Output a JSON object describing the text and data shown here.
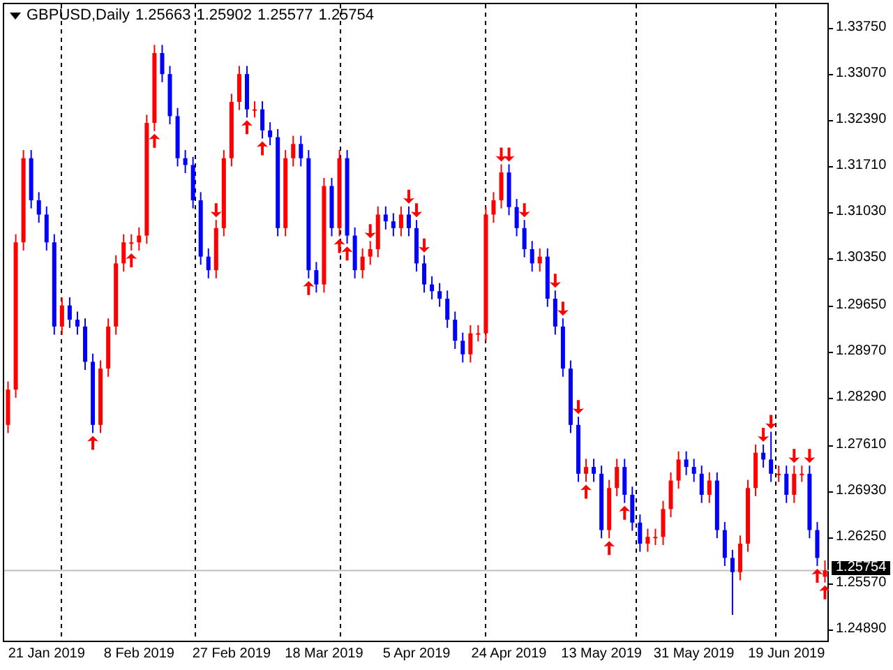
{
  "header": {
    "symbol_timeframe": "GBPUSD,Daily",
    "ohlc": [
      "1.25663",
      "1.25902",
      "1.25577",
      "1.25754"
    ]
  },
  "chart": {
    "chart_data": {
      "type": "candlestick",
      "categories": [
        null,
        null,
        null,
        null,
        null,
        "21 Jan 2019",
        null,
        null,
        null,
        null,
        null,
        null,
        null,
        null,
        null,
        null,
        null,
        "8 Feb 2019",
        null,
        null,
        null,
        null,
        null,
        null,
        null,
        null,
        null,
        null,
        null,
        "27 Feb 2019",
        null,
        null,
        null,
        null,
        null,
        null,
        null,
        null,
        null,
        null,
        null,
        "18 Mar 2019",
        null,
        null,
        null,
        null,
        null,
        null,
        null,
        null,
        null,
        null,
        null,
        "5 Apr 2019",
        null,
        null,
        null,
        null,
        null,
        null,
        null,
        null,
        null,
        null,
        null,
        "24 Apr 2019",
        null,
        null,
        null,
        null,
        null,
        null,
        null,
        null,
        null,
        null,
        null,
        "13 May 2019",
        null,
        null,
        null,
        null,
        null,
        null,
        null,
        null,
        null,
        null,
        null,
        "31 May 2019",
        null,
        null,
        null,
        null,
        null,
        null,
        null,
        null,
        null,
        null,
        null,
        "19 Jun 2019",
        null,
        null,
        null,
        null,
        null
      ],
      "ref_lines": [
        {
          "axis": "y",
          "value": 1.25754
        }
      ],
      "ylim": [
        1.2472,
        1.341
      ],
      "yticks": [
        {
          "value": 1.3375,
          "label": "1.33750"
        },
        {
          "value": 1.3307,
          "label": "1.33070"
        },
        {
          "value": 1.3239,
          "label": "1.32390"
        },
        {
          "value": 1.3171,
          "label": "1.31710"
        },
        {
          "value": 1.3103,
          "label": "1.31030"
        },
        {
          "value": 1.3035,
          "label": "1.30350"
        },
        {
          "value": 1.2965,
          "label": "1.29650"
        },
        {
          "value": 1.2897,
          "label": "1.28970"
        },
        {
          "value": 1.2829,
          "label": "1.28290"
        },
        {
          "value": 1.2761,
          "label": "1.27610"
        },
        {
          "value": 1.2693,
          "label": "1.26930"
        },
        {
          "value": 1.2625,
          "label": "1.26250"
        },
        {
          "value": 1.2557,
          "label": "1.25570"
        },
        {
          "value": 1.2489,
          "label": "1.24890"
        }
      ],
      "ohlc": [
        [
          1.279,
          1.2854,
          1.2778,
          1.2842
        ],
        [
          1.2842,
          1.3071,
          1.283,
          1.3059
        ],
        [
          1.3059,
          1.3195,
          1.3047,
          1.3183
        ],
        [
          1.3183,
          1.3195,
          1.3109,
          1.3121
        ],
        [
          1.3121,
          1.3133,
          1.3088,
          1.31
        ],
        [
          1.31,
          1.3112,
          1.3047,
          1.3059
        ],
        [
          1.3059,
          1.3071,
          1.2923,
          1.2935
        ],
        [
          1.2935,
          1.2978,
          1.2923,
          1.2966
        ],
        [
          1.2966,
          1.2978,
          1.2933,
          1.2945
        ],
        [
          1.2945,
          1.2957,
          1.2923,
          1.2935
        ],
        [
          1.2935,
          1.2947,
          1.2871,
          1.2883
        ],
        [
          1.2883,
          1.2895,
          1.2778,
          1.279
        ],
        [
          1.279,
          1.2885,
          1.2778,
          1.2873
        ],
        [
          1.2873,
          1.2947,
          1.2861,
          1.2935
        ],
        [
          1.2935,
          1.304,
          1.2923,
          1.3028
        ],
        [
          1.3028,
          1.3071,
          1.3016,
          1.3059
        ],
        [
          1.3059,
          1.3071,
          1.3047,
          1.3059
        ],
        [
          1.3059,
          1.3081,
          1.3047,
          1.3069
        ],
        [
          1.3069,
          1.3247,
          1.3057,
          1.3235
        ],
        [
          1.3235,
          1.335,
          1.3223,
          1.3338
        ],
        [
          1.3338,
          1.335,
          1.3295,
          1.3307
        ],
        [
          1.3307,
          1.3319,
          1.3233,
          1.3245
        ],
        [
          1.3245,
          1.3257,
          1.3171,
          1.3183
        ],
        [
          1.3183,
          1.3195,
          1.3161,
          1.3173
        ],
        [
          1.3173,
          1.3185,
          1.3109,
          1.3121
        ],
        [
          1.3121,
          1.3133,
          1.3026,
          1.3038
        ],
        [
          1.3038,
          1.305,
          1.3006,
          1.3018
        ],
        [
          1.3018,
          1.3092,
          1.3006,
          1.308
        ],
        [
          1.308,
          1.3195,
          1.3068,
          1.3183
        ],
        [
          1.3183,
          1.3278,
          1.3171,
          1.3266
        ],
        [
          1.3266,
          1.3319,
          1.3254,
          1.3307
        ],
        [
          1.3307,
          1.3319,
          1.3243,
          1.3255
        ],
        [
          1.3255,
          1.3267,
          1.3243,
          1.3255
        ],
        [
          1.3255,
          1.3267,
          1.3212,
          1.3224
        ],
        [
          1.3224,
          1.3236,
          1.3202,
          1.3214
        ],
        [
          1.3214,
          1.3226,
          1.3068,
          1.308
        ],
        [
          1.308,
          1.3195,
          1.3068,
          1.3183
        ],
        [
          1.3183,
          1.3216,
          1.3171,
          1.3204
        ],
        [
          1.3204,
          1.3216,
          1.3171,
          1.3183
        ],
        [
          1.3183,
          1.3195,
          1.3006,
          1.3018
        ],
        [
          1.3018,
          1.303,
          1.2985,
          1.2997
        ],
        [
          1.2997,
          1.3154,
          1.2985,
          1.3142
        ],
        [
          1.3142,
          1.3154,
          1.3068,
          1.308
        ],
        [
          1.308,
          1.3195,
          1.3068,
          1.3183
        ],
        [
          1.3183,
          1.3195,
          1.3057,
          1.3069
        ],
        [
          1.3069,
          1.3081,
          1.3006,
          1.3018
        ],
        [
          1.3018,
          1.305,
          1.3006,
          1.3038
        ],
        [
          1.3038,
          1.3061,
          1.3026,
          1.3049
        ],
        [
          1.3049,
          1.3112,
          1.3037,
          1.31
        ],
        [
          1.31,
          1.3112,
          1.3078,
          1.309
        ],
        [
          1.309,
          1.3102,
          1.3068,
          1.308
        ],
        [
          1.308,
          1.3112,
          1.3068,
          1.31
        ],
        [
          1.31,
          1.3112,
          1.3068,
          1.308
        ],
        [
          1.308,
          1.3092,
          1.3016,
          1.3028
        ],
        [
          1.3028,
          1.304,
          1.2985,
          1.2997
        ],
        [
          1.2997,
          1.3009,
          1.2975,
          1.2987
        ],
        [
          1.2987,
          1.2999,
          1.2964,
          1.2976
        ],
        [
          1.2976,
          1.2988,
          1.2933,
          1.2945
        ],
        [
          1.2945,
          1.2957,
          1.2902,
          1.2914
        ],
        [
          1.2914,
          1.2926,
          1.2882,
          1.2894
        ],
        [
          1.2894,
          1.2937,
          1.2882,
          1.2925
        ],
        [
          1.2925,
          1.2937,
          1.2913,
          1.2925
        ],
        [
          1.2925,
          1.3112,
          1.2913,
          1.31
        ],
        [
          1.31,
          1.3133,
          1.3088,
          1.3121
        ],
        [
          1.3121,
          1.3174,
          1.3109,
          1.3162
        ],
        [
          1.3162,
          1.3174,
          1.3099,
          1.3111
        ],
        [
          1.3111,
          1.3123,
          1.3068,
          1.308
        ],
        [
          1.308,
          1.3092,
          1.3037,
          1.3049
        ],
        [
          1.3049,
          1.3061,
          1.3016,
          1.3028
        ],
        [
          1.3028,
          1.305,
          1.3016,
          1.3038
        ],
        [
          1.3038,
          1.305,
          1.2964,
          1.2976
        ],
        [
          1.2976,
          1.2988,
          1.2923,
          1.2935
        ],
        [
          1.2935,
          1.2947,
          1.2861,
          1.2873
        ],
        [
          1.2873,
          1.2885,
          1.2778,
          1.279
        ],
        [
          1.279,
          1.2802,
          1.2706,
          1.2718
        ],
        [
          1.2718,
          1.274,
          1.2706,
          1.2728
        ],
        [
          1.2728,
          1.274,
          1.2706,
          1.2718
        ],
        [
          1.2718,
          1.273,
          1.2623,
          1.2635
        ],
        [
          1.2635,
          1.2709,
          1.2623,
          1.2697
        ],
        [
          1.2697,
          1.274,
          1.2685,
          1.2728
        ],
        [
          1.2728,
          1.274,
          1.2675,
          1.2687
        ],
        [
          1.2687,
          1.2699,
          1.2634,
          1.2646
        ],
        [
          1.2646,
          1.2658,
          1.2603,
          1.2615
        ],
        [
          1.2615,
          1.2637,
          1.2603,
          1.2625
        ],
        [
          1.2625,
          1.2637,
          1.2613,
          1.2625
        ],
        [
          1.2625,
          1.2678,
          1.2613,
          1.2666
        ],
        [
          1.2666,
          1.272,
          1.2654,
          1.2708
        ],
        [
          1.2708,
          1.2751,
          1.2696,
          1.2739
        ],
        [
          1.2739,
          1.2751,
          1.2716,
          1.2728
        ],
        [
          1.2728,
          1.274,
          1.2706,
          1.2718
        ],
        [
          1.2718,
          1.273,
          1.2675,
          1.2687
        ],
        [
          1.2687,
          1.272,
          1.2675,
          1.2708
        ],
        [
          1.2708,
          1.272,
          1.2623,
          1.2635
        ],
        [
          1.2635,
          1.2647,
          1.2582,
          1.2594
        ],
        [
          1.2594,
          1.2606,
          1.251,
          1.2573
        ],
        [
          1.2573,
          1.2627,
          1.2561,
          1.2615
        ],
        [
          1.2615,
          1.2709,
          1.2603,
          1.2697
        ],
        [
          1.2697,
          1.2761,
          1.2685,
          1.2749
        ],
        [
          1.2749,
          1.2761,
          1.2727,
          1.2739
        ],
        [
          1.2739,
          1.278,
          1.2706,
          1.2718
        ],
        [
          1.2718,
          1.273,
          1.2706,
          1.2718
        ],
        [
          1.2718,
          1.273,
          1.2675,
          1.2687
        ],
        [
          1.2687,
          1.273,
          1.2675,
          1.2718
        ],
        [
          1.2718,
          1.273,
          1.2706,
          1.2718
        ],
        [
          1.2718,
          1.273,
          1.2623,
          1.2635
        ],
        [
          1.2635,
          1.2647,
          1.2582,
          1.2594
        ],
        [
          1.25663,
          1.25902,
          1.25577,
          1.25754
        ]
      ]
    }
  },
  "price_axis": {
    "current_price": "1.25754"
  }
}
